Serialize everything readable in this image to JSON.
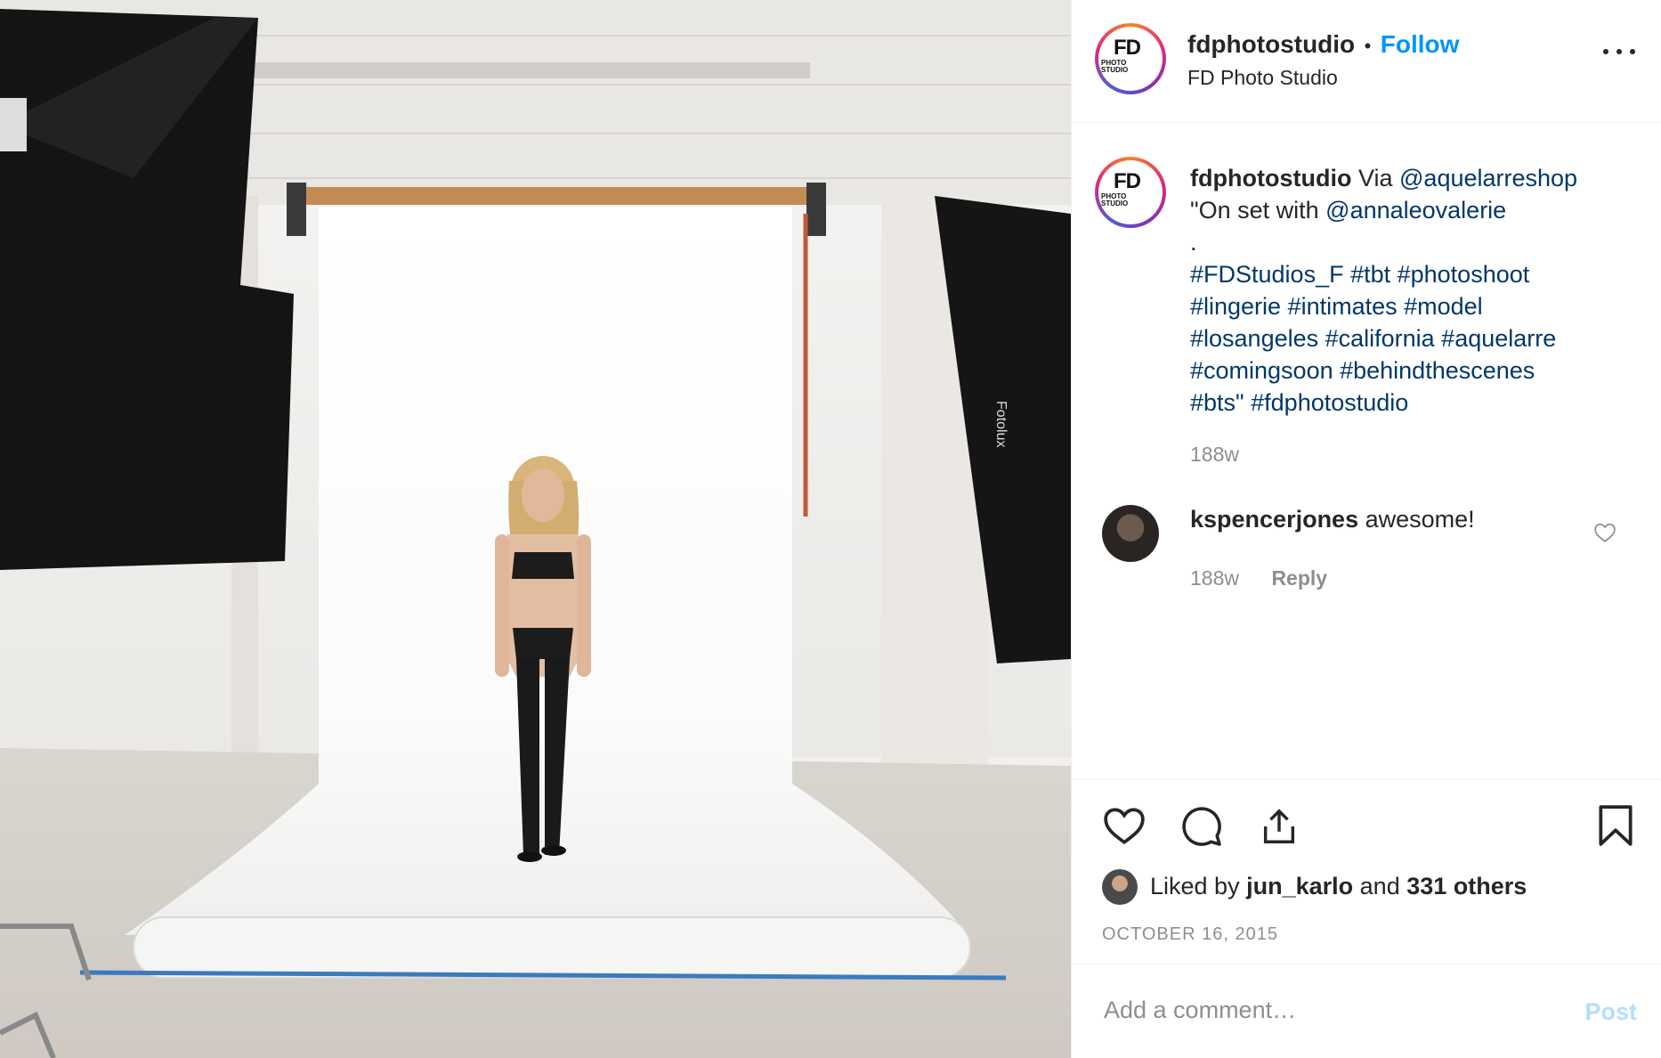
{
  "post": {
    "account": {
      "username": "fdphotostudio",
      "display_name": "FD Photo Studio",
      "follow_label": "Follow",
      "separator": "•",
      "avatar_text_main": "FD",
      "avatar_text_sub": "PHOTO STUDIO"
    },
    "caption": {
      "username": "fdphotostudio",
      "via": "Via",
      "mention_1": "@aquelarreshop",
      "line_2_prefix": "\"On set with",
      "mention_2": "@annaleovalerie",
      "dot": ".",
      "hashtags_line_1": "#FDStudios_F #tbt #photoshoot",
      "hashtags_line_2": "#lingerie #intimates #model",
      "hashtags_line_3": "#losangeles #california #aquelarre",
      "hashtags_line_4": "#comingsoon #behindthescenes",
      "hashtags_line_5a": "#bts\"",
      "hashtags_line_5b": "#fdphotostudio",
      "age": "188w"
    },
    "comments": [
      {
        "username": "kspencerjones",
        "text": "awesome!",
        "age": "188w",
        "reply_label": "Reply"
      }
    ],
    "likes": {
      "prefix": "Liked by",
      "user": "jun_karlo",
      "and": "and",
      "others": "331 others"
    },
    "date": "OCTOBER 16, 2015",
    "add_comment": {
      "placeholder": "Add a comment…",
      "post_label": "Post"
    },
    "photo": {
      "softbox_brand": "Fotolux"
    },
    "colors": {
      "link": "#00376b",
      "follow": "#0095f6",
      "muted": "#8e8e8e",
      "post_disabled": "#b2dffc"
    },
    "icons": [
      "heart-icon",
      "comment-icon",
      "share-icon",
      "bookmark-icon",
      "more-options-icon",
      "small-heart-icon"
    ]
  }
}
